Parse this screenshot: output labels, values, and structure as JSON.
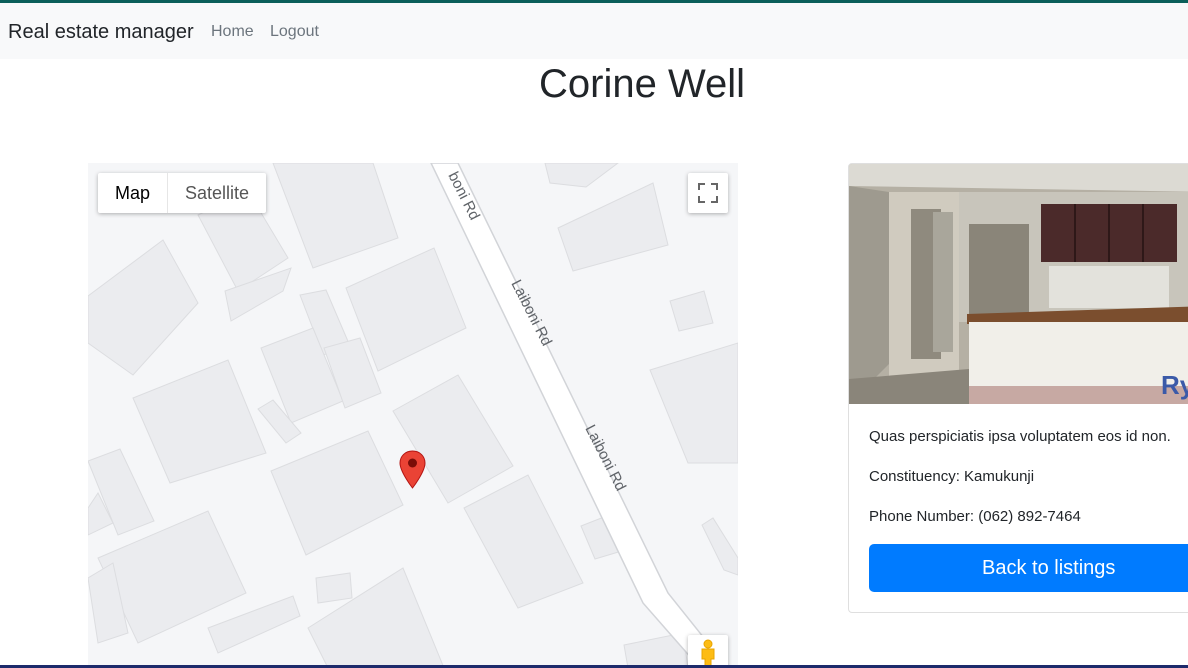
{
  "navbar": {
    "brand": "Real estate manager",
    "links": [
      "Home",
      "Logout"
    ]
  },
  "page": {
    "title": "Corine Well"
  },
  "map": {
    "type_buttons": [
      "Map",
      "Satellite"
    ],
    "active_type": "Map",
    "road_label": "Laiboni Rd",
    "road_label_partial": "boni Rd",
    "icons": [
      "fullscreen-icon",
      "pegman-icon",
      "map-marker-icon"
    ]
  },
  "listing": {
    "description": "Quas perspiciatis ipsa voluptatem eos id non.",
    "constituency": "Constituency: Kamukunji",
    "phone": "Phone Number: (062) 892-7464",
    "back_label": "Back to listings"
  },
  "colors": {
    "primary": "#007bff",
    "navbar_bg": "#f8f9fa",
    "marker": "#ea4335"
  }
}
